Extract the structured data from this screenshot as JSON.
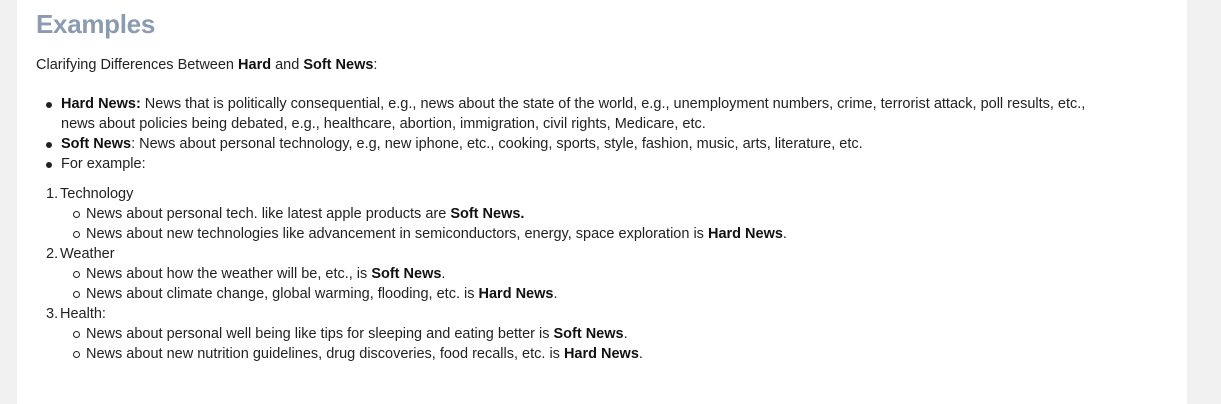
{
  "heading": "Examples",
  "intro": {
    "pre": "Clarifying Differences Between ",
    "hard": "Hard",
    "mid": " and ",
    "soft": "Soft News",
    "post": ":"
  },
  "bullets": [
    {
      "label": "Hard News:",
      "line1": " News that is politically consequential, e.g., news about the state of the world, e.g., unemployment numbers, crime, terrorist attack, poll results, etc.,",
      "line2": "news about policies being debated, e.g., healthcare, abortion, immigration, civil rights, Medicare, etc."
    },
    {
      "label": "Soft News",
      "text": ": News about personal technology, e.g, new iphone, etc., cooking, sports, style, fashion, music, arts, literature, etc."
    },
    {
      "text": "For example:"
    }
  ],
  "examples": [
    {
      "num": "1.",
      "title": "Technology",
      "items": [
        {
          "text": "News about personal tech. like latest apple products are ",
          "bold": "Soft News.",
          "end": ""
        },
        {
          "text": "News about new technologies like advancement in semiconductors, energy, space exploration is ",
          "bold": "Hard News",
          "end": "."
        }
      ]
    },
    {
      "num": "2.",
      "title": "Weather",
      "items": [
        {
          "text": "News about how the weather will be, etc., is ",
          "bold": "Soft News",
          "end": "."
        },
        {
          "text": "News about climate change, global warming, flooding, etc. is ",
          "bold": "Hard News",
          "end": "."
        }
      ]
    },
    {
      "num": "3.",
      "title": "Health:",
      "items": [
        {
          "text": "News about personal well being like tips for sleeping and eating better is ",
          "bold": "Soft News",
          "end": "."
        },
        {
          "text": "News about new nutrition guidelines, drug discoveries, food recalls, etc. is ",
          "bold": "Hard News",
          "end": "."
        }
      ]
    }
  ]
}
